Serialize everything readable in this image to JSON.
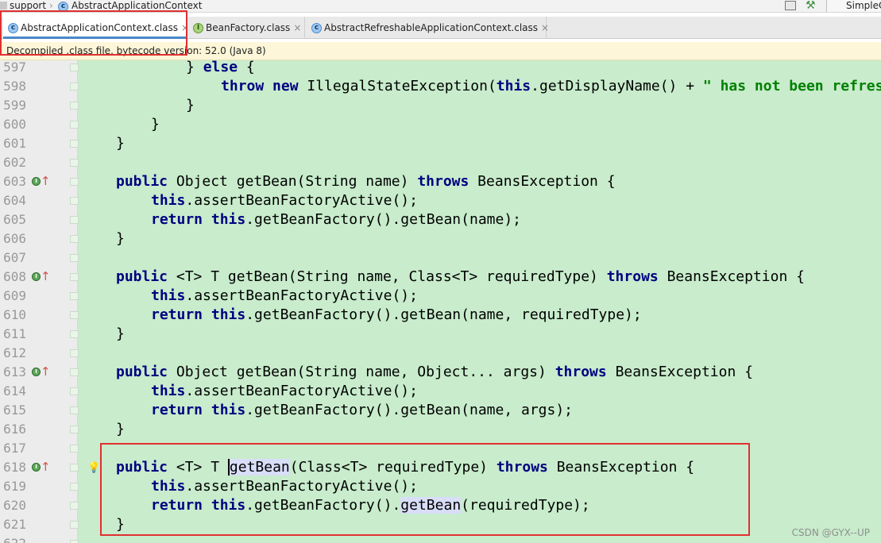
{
  "breadcrumb": {
    "items": [
      "support",
      "AbstractApplicationContext"
    ],
    "right_tab_label": "SimpleC"
  },
  "tabs": [
    {
      "label": "AbstractApplicationContext.class",
      "icon": "class-icon",
      "active": true
    },
    {
      "label": "BeanFactory.class",
      "icon": "interface-icon",
      "active": false
    },
    {
      "label": "AbstractRefreshableApplicationContext.class",
      "icon": "class-icon",
      "active": false
    }
  ],
  "tab_close_glyph": "×",
  "notice": "Decompiled .class file, bytecode version: 52.0 (Java 8)",
  "editor": {
    "lines": [
      {
        "num": "597",
        "indent": 2,
        "tokens": [
          [
            "",
            "} "
          ],
          [
            "kw",
            "else"
          ],
          [
            "",
            " {"
          ]
        ]
      },
      {
        "num": "598",
        "indent": 3,
        "tokens": [
          [
            "kw",
            "throw new"
          ],
          [
            "",
            " IllegalStateException("
          ],
          [
            "kw",
            "this"
          ],
          [
            "",
            ".getDisplayName() + "
          ],
          [
            "str",
            "\" has not been refreshed yet\""
          ],
          [
            "",
            ");"
          ]
        ]
      },
      {
        "num": "599",
        "indent": 2,
        "tokens": [
          [
            "",
            "}"
          ]
        ]
      },
      {
        "num": "600",
        "indent": 1,
        "tokens": [
          [
            "",
            "}"
          ]
        ]
      },
      {
        "num": "601",
        "indent": 0,
        "tokens": [
          [
            "",
            "}"
          ]
        ]
      },
      {
        "num": "602",
        "indent": 0,
        "tokens": []
      },
      {
        "num": "603",
        "indent": 0,
        "marker": true,
        "tokens": [
          [
            "kw",
            "public"
          ],
          [
            "",
            " Object getBean(String name) "
          ],
          [
            "kw",
            "throws"
          ],
          [
            "",
            " BeansException {"
          ]
        ]
      },
      {
        "num": "604",
        "indent": 1,
        "tokens": [
          [
            "kw",
            "this"
          ],
          [
            "",
            ".assertBeanFactoryActive();"
          ]
        ]
      },
      {
        "num": "605",
        "indent": 1,
        "tokens": [
          [
            "kw",
            "return this"
          ],
          [
            "",
            ".getBeanFactory().getBean(name);"
          ]
        ]
      },
      {
        "num": "606",
        "indent": 0,
        "tokens": [
          [
            "",
            "}"
          ]
        ]
      },
      {
        "num": "607",
        "indent": 0,
        "tokens": []
      },
      {
        "num": "608",
        "indent": 0,
        "marker": true,
        "tokens": [
          [
            "kw",
            "public"
          ],
          [
            "",
            " <T> T getBean(String name, Class<T> requiredType) "
          ],
          [
            "kw",
            "throws"
          ],
          [
            "",
            " BeansException {"
          ]
        ]
      },
      {
        "num": "609",
        "indent": 1,
        "tokens": [
          [
            "kw",
            "this"
          ],
          [
            "",
            ".assertBeanFactoryActive();"
          ]
        ]
      },
      {
        "num": "610",
        "indent": 1,
        "tokens": [
          [
            "kw",
            "return this"
          ],
          [
            "",
            ".getBeanFactory().getBean(name, requiredType);"
          ]
        ]
      },
      {
        "num": "611",
        "indent": 0,
        "tokens": [
          [
            "",
            "}"
          ]
        ]
      },
      {
        "num": "612",
        "indent": 0,
        "tokens": []
      },
      {
        "num": "613",
        "indent": 0,
        "marker": true,
        "tokens": [
          [
            "kw",
            "public"
          ],
          [
            "",
            " Object getBean(String name, Object... args) "
          ],
          [
            "kw",
            "throws"
          ],
          [
            "",
            " BeansException {"
          ]
        ]
      },
      {
        "num": "614",
        "indent": 1,
        "tokens": [
          [
            "kw",
            "this"
          ],
          [
            "",
            ".assertBeanFactoryActive();"
          ]
        ]
      },
      {
        "num": "615",
        "indent": 1,
        "tokens": [
          [
            "kw",
            "return this"
          ],
          [
            "",
            ".getBeanFactory().getBean(name, args);"
          ]
        ]
      },
      {
        "num": "616",
        "indent": 0,
        "tokens": [
          [
            "",
            "}"
          ]
        ]
      },
      {
        "num": "617",
        "indent": 0,
        "tokens": []
      },
      {
        "num": "618",
        "indent": 0,
        "marker": true,
        "bulb": true,
        "tokens": [
          [
            "kw",
            "public"
          ],
          [
            "",
            " <T> T "
          ],
          [
            "caret",
            ""
          ],
          [
            "hl",
            "getBean"
          ],
          [
            "",
            "(Class<T> requiredType) "
          ],
          [
            "kw",
            "throws"
          ],
          [
            "",
            " BeansException {"
          ]
        ]
      },
      {
        "num": "619",
        "indent": 1,
        "tokens": [
          [
            "kw",
            "this"
          ],
          [
            "",
            ".assertBeanFactoryActive();"
          ]
        ]
      },
      {
        "num": "620",
        "indent": 1,
        "tokens": [
          [
            "kw",
            "return this"
          ],
          [
            "",
            ".getBeanFactory()."
          ],
          [
            "hl",
            "getBean"
          ],
          [
            "",
            "(requiredType);"
          ]
        ]
      },
      {
        "num": "621",
        "indent": 0,
        "tokens": [
          [
            "",
            "}"
          ]
        ]
      },
      {
        "num": "622",
        "indent": 0,
        "tokens": []
      }
    ]
  },
  "watermark": "CSDN @GYX--UP",
  "colors": {
    "keyword": "#000080",
    "string": "#008000",
    "editor_bg": "#c8eccc",
    "highlight_box": "#e03030"
  }
}
